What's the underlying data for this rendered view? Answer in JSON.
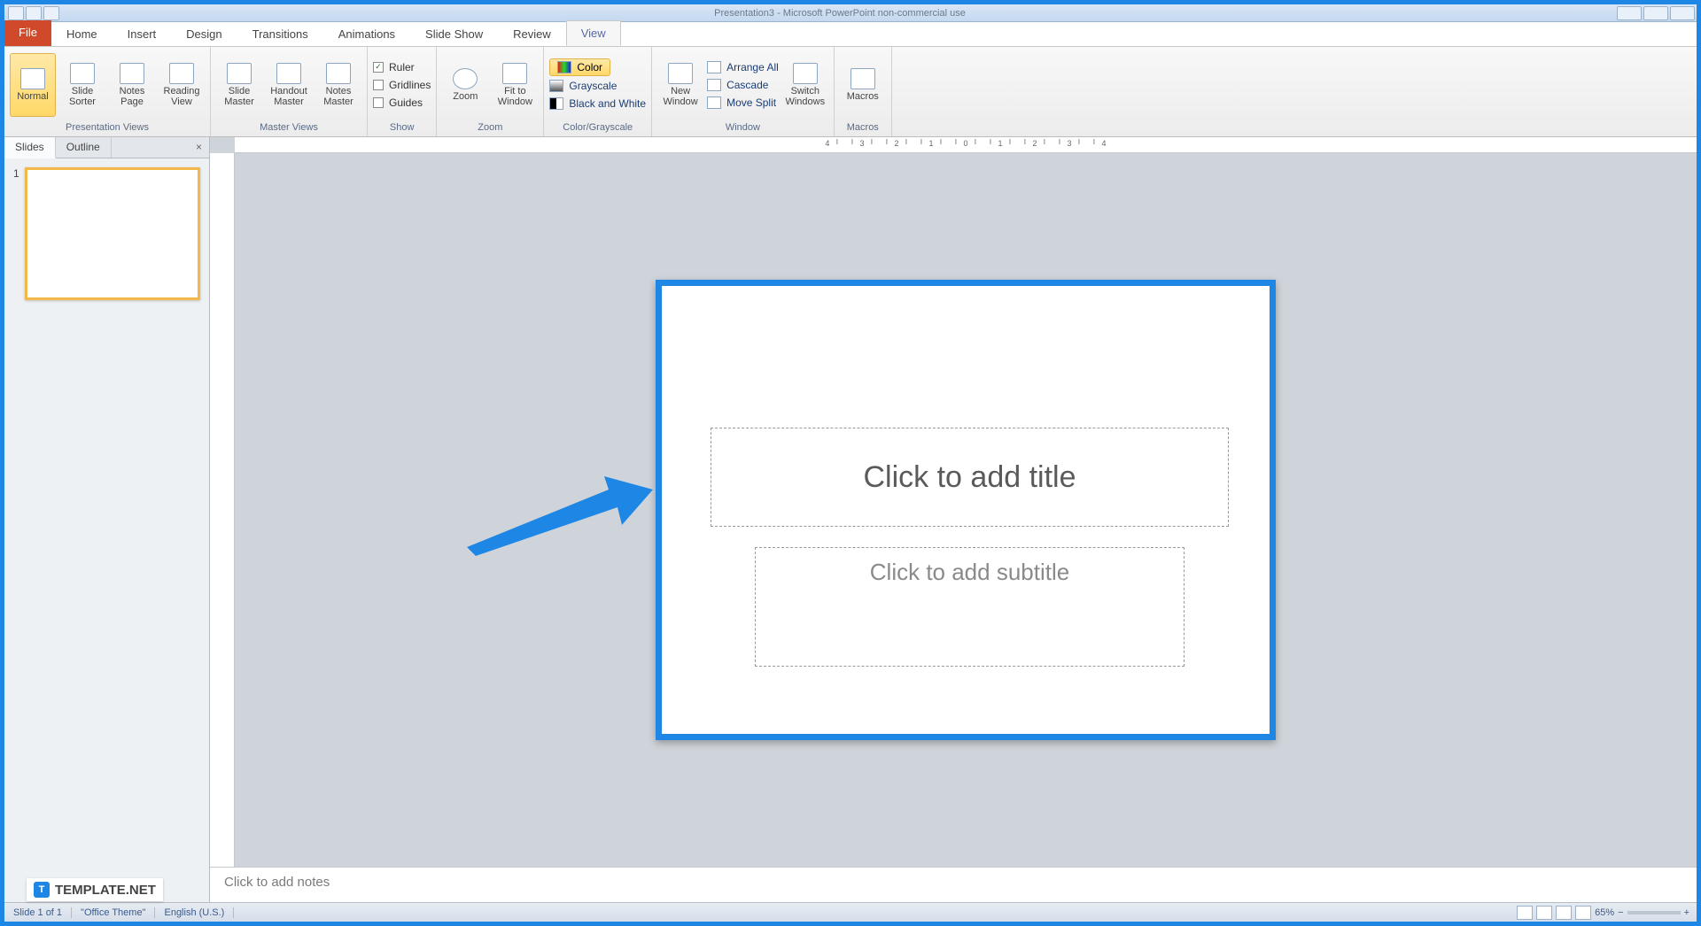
{
  "titlebar": {
    "title": "Presentation3 - Microsoft PowerPoint non-commercial use"
  },
  "tabs": {
    "file": "File",
    "items": [
      "Home",
      "Insert",
      "Design",
      "Transitions",
      "Animations",
      "Slide Show",
      "Review",
      "View"
    ],
    "active": "View"
  },
  "ribbon": {
    "presentation_views": {
      "label": "Presentation Views",
      "normal": "Normal",
      "slide_sorter": "Slide\nSorter",
      "notes_page": "Notes\nPage",
      "reading_view": "Reading\nView"
    },
    "master_views": {
      "label": "Master Views",
      "slide_master": "Slide\nMaster",
      "handout_master": "Handout\nMaster",
      "notes_master": "Notes\nMaster"
    },
    "show": {
      "label": "Show",
      "ruler": "Ruler",
      "gridlines": "Gridlines",
      "guides": "Guides"
    },
    "zoom": {
      "label": "Zoom",
      "zoom": "Zoom",
      "fit": "Fit to\nWindow"
    },
    "color": {
      "label": "Color/Grayscale",
      "color": "Color",
      "grayscale": "Grayscale",
      "bw": "Black and White"
    },
    "window": {
      "label": "Window",
      "new_window": "New\nWindow",
      "arrange": "Arrange All",
      "cascade": "Cascade",
      "move_split": "Move Split",
      "switch": "Switch\nWindows"
    },
    "macros": {
      "label": "Macros",
      "macros": "Macros"
    }
  },
  "leftpanel": {
    "slides": "Slides",
    "outline": "Outline"
  },
  "slide": {
    "title_ph": "Click to add title",
    "subtitle_ph": "Click to add subtitle"
  },
  "notes": {
    "placeholder": "Click to add notes"
  },
  "statusbar": {
    "slide": "Slide 1 of 1",
    "theme": "\"Office Theme\"",
    "lang": "English (U.S.)",
    "zoom": "65%"
  },
  "watermark": "TEMPLATE.NET",
  "ruler_ticks": [
    "4",
    "3",
    "2",
    "1",
    "0",
    "1",
    "2",
    "3",
    "4"
  ]
}
